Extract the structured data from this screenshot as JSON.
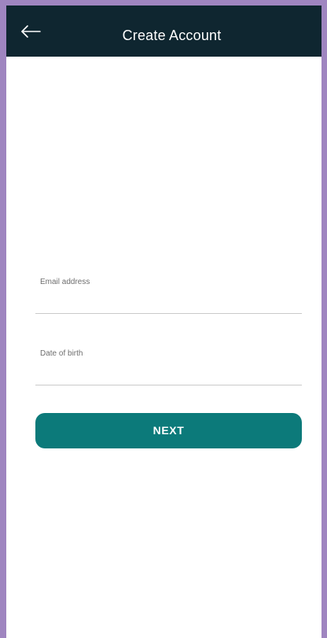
{
  "header": {
    "title": "Create Account"
  },
  "form": {
    "email_label": "Email address",
    "email_value": "",
    "dob_label": "Date of birth",
    "dob_value": ""
  },
  "actions": {
    "next_label": "NEXT"
  },
  "colors": {
    "app_bar": "#0f2630",
    "accent_button": "#0c7a7a",
    "frame_border": "#9f85c0"
  }
}
